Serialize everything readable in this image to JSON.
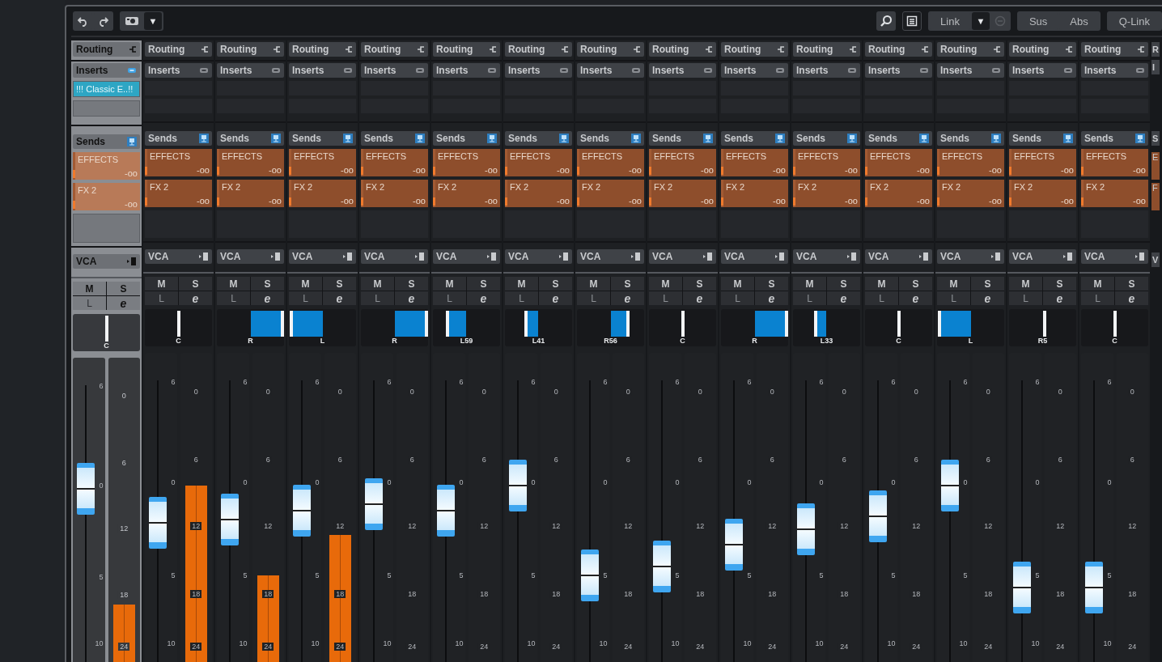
{
  "toolbar": {
    "camera_menu": "▼",
    "link": {
      "label": "Link",
      "menu": "▼",
      "on": false
    },
    "sus": "Sus",
    "abs": "Abs",
    "qlink": "Q-Link"
  },
  "channels": [
    {
      "selected": true,
      "routing": "Routing",
      "inserts": "Inserts",
      "inserts_on": true,
      "slots": [
        "!!! Classic E..!!"
      ],
      "sends": "Sends",
      "send_list": [
        {
          "name": "EFFECTS",
          "value": "-oo"
        },
        {
          "name": "FX 2",
          "value": "-oo"
        }
      ],
      "vca": "VCA",
      "mute": "M",
      "solo": "S",
      "read": "L",
      "edit": "e",
      "pan": {
        "label": "C",
        "level": 0.5
      },
      "fader": {
        "level": 0.57
      },
      "meter": {
        "level": 0.19
      },
      "fader_ticks": [
        "6",
        "0",
        "5",
        "10"
      ],
      "meter_ticks": [
        "0",
        "6",
        "12",
        "18",
        "24"
      ]
    },
    {
      "selected": false,
      "routing": "Routing",
      "inserts": "Inserts",
      "inserts_on": false,
      "sends": "Sends",
      "send_list": [
        {
          "name": "EFFECTS",
          "value": "-oo"
        },
        {
          "name": "FX 2",
          "value": "-oo"
        }
      ],
      "vca": "VCA",
      "mute": "M",
      "solo": "S",
      "read": "L",
      "edit": "e",
      "pan": {
        "label": "C",
        "level": 0.5
      },
      "fader": {
        "level": 0.45
      },
      "meter": {
        "level": 0.57
      },
      "fader_ticks": [
        "6",
        "0",
        "5",
        "10"
      ],
      "meter_ticks": [
        "0",
        "6",
        "12",
        "18",
        "24"
      ]
    },
    {
      "selected": false,
      "routing": "Routing",
      "inserts": "Inserts",
      "inserts_on": false,
      "sends": "Sends",
      "send_list": [
        {
          "name": "EFFECTS",
          "value": "-oo"
        },
        {
          "name": "FX 2",
          "value": "-oo"
        }
      ],
      "vca": "VCA",
      "mute": "M",
      "solo": "S",
      "read": "L",
      "edit": "e",
      "pan": {
        "label": "R",
        "level": 1
      },
      "fader": {
        "level": 0.46
      },
      "meter": {
        "level": 0.28
      },
      "fader_ticks": [
        "6",
        "0",
        "5",
        "10"
      ],
      "meter_ticks": [
        "0",
        "6",
        "12",
        "18",
        "24"
      ]
    },
    {
      "selected": false,
      "routing": "Routing",
      "inserts": "Inserts",
      "inserts_on": false,
      "sends": "Sends",
      "send_list": [
        {
          "name": "EFFECTS",
          "value": "-oo"
        },
        {
          "name": "FX 2",
          "value": "-oo"
        }
      ],
      "vca": "VCA",
      "mute": "M",
      "solo": "S",
      "read": "L",
      "edit": "e",
      "pan": {
        "label": "L",
        "level": 0
      },
      "fader": {
        "level": 0.49
      },
      "meter": {
        "level": 0.41
      },
      "fader_ticks": [
        "6",
        "0",
        "5",
        "10"
      ],
      "meter_ticks": [
        "0",
        "6",
        "12",
        "18",
        "24"
      ]
    },
    {
      "selected": false,
      "routing": "Routing",
      "inserts": "Inserts",
      "inserts_on": false,
      "sends": "Sends",
      "send_list": [
        {
          "name": "EFFECTS",
          "value": "-oo"
        },
        {
          "name": "FX 2",
          "value": "-oo"
        }
      ],
      "vca": "VCA",
      "mute": "M",
      "solo": "S",
      "read": "L",
      "edit": "e",
      "pan": {
        "label": "R",
        "level": 1
      },
      "fader": {
        "level": 0.51
      },
      "meter": {
        "level": 0
      },
      "fader_ticks": [
        "6",
        "0",
        "5",
        "10"
      ],
      "meter_ticks": [
        "0",
        "6",
        "12",
        "18",
        "24"
      ]
    },
    {
      "selected": false,
      "routing": "Routing",
      "inserts": "Inserts",
      "inserts_on": false,
      "sends": "Sends",
      "send_list": [
        {
          "name": "EFFECTS",
          "value": "-oo"
        },
        {
          "name": "FX 2",
          "value": "-oo"
        }
      ],
      "vca": "VCA",
      "mute": "M",
      "solo": "S",
      "read": "L",
      "edit": "e",
      "pan": {
        "label": "L59",
        "level": 0.2
      },
      "fader": {
        "level": 0.49
      },
      "meter": {
        "level": 0
      },
      "fader_ticks": [
        "6",
        "0",
        "5",
        "10"
      ],
      "meter_ticks": [
        "0",
        "6",
        "12",
        "18",
        "24"
      ]
    },
    {
      "selected": false,
      "routing": "Routing",
      "inserts": "Inserts",
      "inserts_on": false,
      "sends": "Sends",
      "send_list": [
        {
          "name": "EFFECTS",
          "value": "-oo"
        },
        {
          "name": "FX 2",
          "value": "-oo"
        }
      ],
      "vca": "VCA",
      "mute": "M",
      "solo": "S",
      "read": "L",
      "edit": "e",
      "pan": {
        "label": "L41",
        "level": 0.3
      },
      "fader": {
        "level": 0.57
      },
      "meter": {
        "level": 0
      },
      "fader_ticks": [
        "6",
        "0",
        "5",
        "10"
      ],
      "meter_ticks": [
        "0",
        "6",
        "12",
        "18",
        "24"
      ]
    },
    {
      "selected": false,
      "routing": "Routing",
      "inserts": "Inserts",
      "inserts_on": false,
      "sends": "Sends",
      "send_list": [
        {
          "name": "EFFECTS",
          "value": "-oo"
        },
        {
          "name": "FX 2",
          "value": "-oo"
        }
      ],
      "vca": "VCA",
      "mute": "M",
      "solo": "S",
      "read": "L",
      "edit": "e",
      "pan": {
        "label": "R56",
        "level": 0.78
      },
      "fader": {
        "level": 0.28
      },
      "meter": {
        "level": 0
      },
      "fader_ticks": [
        "6",
        "0",
        "5",
        "10"
      ],
      "meter_ticks": [
        "0",
        "6",
        "12",
        "18",
        "24"
      ]
    },
    {
      "selected": false,
      "routing": "Routing",
      "inserts": "Inserts",
      "inserts_on": false,
      "sends": "Sends",
      "send_list": [
        {
          "name": "EFFECTS",
          "value": "-oo"
        },
        {
          "name": "FX 2",
          "value": "-oo"
        }
      ],
      "vca": "VCA",
      "mute": "M",
      "solo": "S",
      "read": "L",
      "edit": "e",
      "pan": {
        "label": "C",
        "level": 0.5
      },
      "fader": {
        "level": 0.31
      },
      "meter": {
        "level": 0
      },
      "fader_ticks": [
        "6",
        "0",
        "5",
        "10"
      ],
      "meter_ticks": [
        "0",
        "6",
        "12",
        "18",
        "24"
      ]
    },
    {
      "selected": false,
      "routing": "Routing",
      "inserts": "Inserts",
      "inserts_on": false,
      "sends": "Sends",
      "send_list": [
        {
          "name": "EFFECTS",
          "value": "-oo"
        },
        {
          "name": "FX 2",
          "value": "-oo"
        }
      ],
      "vca": "VCA",
      "mute": "M",
      "solo": "S",
      "read": "L",
      "edit": "e",
      "pan": {
        "label": "R",
        "level": 1
      },
      "fader": {
        "level": 0.38
      },
      "meter": {
        "level": 0
      },
      "fader_ticks": [
        "6",
        "0",
        "5",
        "10"
      ],
      "meter_ticks": [
        "0",
        "6",
        "12",
        "18",
        "24"
      ]
    },
    {
      "selected": false,
      "routing": "Routing",
      "inserts": "Inserts",
      "inserts_on": false,
      "sends": "Sends",
      "send_list": [
        {
          "name": "EFFECTS",
          "value": "-oo"
        },
        {
          "name": "FX 2",
          "value": "-oo"
        }
      ],
      "vca": "VCA",
      "mute": "M",
      "solo": "S",
      "read": "L",
      "edit": "e",
      "pan": {
        "label": "L33",
        "level": 0.33
      },
      "fader": {
        "level": 0.43
      },
      "meter": {
        "level": 0
      },
      "fader_ticks": [
        "6",
        "0",
        "5",
        "10"
      ],
      "meter_ticks": [
        "0",
        "6",
        "12",
        "18",
        "24"
      ]
    },
    {
      "selected": false,
      "routing": "Routing",
      "inserts": "Inserts",
      "inserts_on": false,
      "sends": "Sends",
      "send_list": [
        {
          "name": "EFFECTS",
          "value": "-oo"
        },
        {
          "name": "FX 2",
          "value": "-oo"
        }
      ],
      "vca": "VCA",
      "mute": "M",
      "solo": "S",
      "read": "L",
      "edit": "e",
      "pan": {
        "label": "C",
        "level": 0.5
      },
      "fader": {
        "level": 0.47
      },
      "meter": {
        "level": 0
      },
      "fader_ticks": [
        "6",
        "0",
        "5",
        "10"
      ],
      "meter_ticks": [
        "0",
        "6",
        "12",
        "18",
        "24"
      ]
    },
    {
      "selected": false,
      "routing": "Routing",
      "inserts": "Inserts",
      "inserts_on": false,
      "sends": "Sends",
      "send_list": [
        {
          "name": "EFFECTS",
          "value": "-oo"
        },
        {
          "name": "FX 2",
          "value": "-oo"
        }
      ],
      "vca": "VCA",
      "mute": "M",
      "solo": "S",
      "read": "L",
      "edit": "e",
      "pan": {
        "label": "L",
        "level": 0
      },
      "fader": {
        "level": 0.57
      },
      "meter": {
        "level": 0
      },
      "fader_ticks": [
        "6",
        "0",
        "5",
        "10"
      ],
      "meter_ticks": [
        "0",
        "6",
        "12",
        "18",
        "24"
      ]
    },
    {
      "selected": false,
      "routing": "Routing",
      "inserts": "Inserts",
      "inserts_on": false,
      "sends": "Sends",
      "send_list": [
        {
          "name": "EFFECTS",
          "value": "-oo"
        },
        {
          "name": "FX 2",
          "value": "-oo"
        }
      ],
      "vca": "VCA",
      "mute": "M",
      "solo": "S",
      "read": "L",
      "edit": "e",
      "pan": {
        "label": "R5",
        "level": 0.53
      },
      "fader": {
        "level": 0.24
      },
      "meter": {
        "level": 0
      },
      "fader_ticks": [
        "6",
        "0",
        "5",
        "10"
      ],
      "meter_ticks": [
        "0",
        "6",
        "12",
        "18",
        "24"
      ]
    },
    {
      "selected": false,
      "routing": "Routing",
      "inserts": "Inserts",
      "inserts_on": false,
      "sends": "Sends",
      "send_list": [
        {
          "name": "EFFECTS",
          "value": "-oo"
        },
        {
          "name": "FX 2",
          "value": "-oo"
        }
      ],
      "vca": "VCA",
      "mute": "M",
      "solo": "S",
      "read": "L",
      "edit": "e",
      "pan": {
        "label": "C",
        "level": 0.5
      },
      "fader": {
        "level": 0.24
      },
      "meter": {
        "level": 0
      },
      "fader_ticks": [
        "6",
        "0",
        "5",
        "10"
      ],
      "meter_ticks": [
        "0",
        "6",
        "12",
        "18",
        "24"
      ]
    }
  ],
  "edge_channel": {
    "routing": "R",
    "inserts": "I",
    "sends": "S",
    "effects": "E",
    "fx2": "F",
    "vca": "V"
  }
}
